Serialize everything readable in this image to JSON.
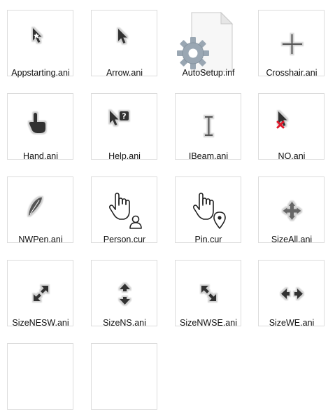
{
  "files": [
    {
      "name": "Appstarting.ani",
      "icon": "appstarting-cursor-icon"
    },
    {
      "name": "Arrow.ani",
      "icon": "arrow-cursor-icon"
    },
    {
      "name": "AutoSetup.inf",
      "icon": "settings-file-icon"
    },
    {
      "name": "Crosshair.ani",
      "icon": "crosshair-cursor-icon"
    },
    {
      "name": "Hand.ani",
      "icon": "hand-cursor-icon"
    },
    {
      "name": "Help.ani",
      "icon": "help-cursor-icon"
    },
    {
      "name": "IBeam.ani",
      "icon": "ibeam-cursor-icon"
    },
    {
      "name": "NO.ani",
      "icon": "no-cursor-icon"
    },
    {
      "name": "NWPen.ani",
      "icon": "pen-cursor-icon"
    },
    {
      "name": "Person.cur",
      "icon": "person-cursor-icon"
    },
    {
      "name": "Pin.cur",
      "icon": "pin-cursor-icon"
    },
    {
      "name": "SizeAll.ani",
      "icon": "sizeall-cursor-icon"
    },
    {
      "name": "SizeNESW.ani",
      "icon": "size-nesw-cursor-icon"
    },
    {
      "name": "SizeNS.ani",
      "icon": "size-ns-cursor-icon"
    },
    {
      "name": "SizeNWSE.ani",
      "icon": "size-nwse-cursor-icon"
    },
    {
      "name": "SizeWE.ani",
      "icon": "size-we-cursor-icon"
    }
  ],
  "colors": {
    "cursor_fill": "#333333",
    "cursor_outline": "#d8d8d8",
    "no_symbol": "#e0182b",
    "gear": "#9aa7b3"
  }
}
